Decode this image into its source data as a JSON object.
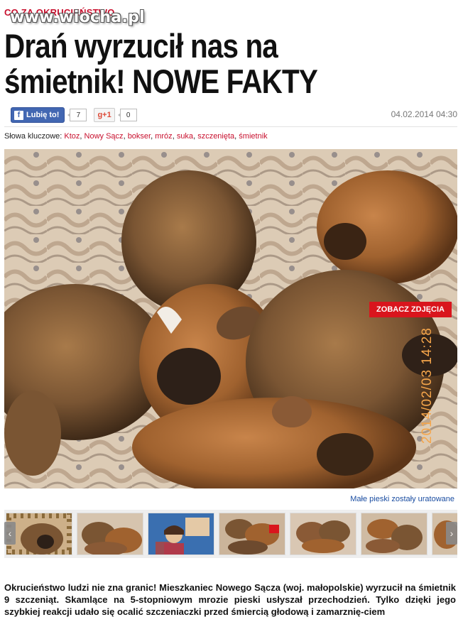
{
  "header": {
    "kicker": "CO ZA OKRUCIEŃSTWO",
    "watermark": "www.wiocha.pl"
  },
  "article": {
    "title": "Drań wyrzucił nas na śmietnik! NOWE FAKTY",
    "date": "04.02.2014 04:30",
    "keywords_label": "Słowa kluczowe:",
    "keywords": [
      "Ktoz",
      "Nowy Sącz",
      "bokser",
      "mróz",
      "suka",
      "szczenięta",
      "śmietnik"
    ],
    "body": "Okrucieństwo ludzi nie zna granic! Mieszkaniec Nowego Sącza (woj. małopolskie) wyrzucił na śmietnik 9 szczeniąt. Skamlące na 5-stopniowym mrozie pieski usłyszał przechodzień. Tylko dzięki jego szybkiej reakcji udało się ocalić szczeniaczki przed śmiercią głodową i zamarznię-ciem"
  },
  "social": {
    "fb_icon": "f",
    "fb_label": "Lubię to!",
    "fb_count": "7",
    "gplus_label": "g+1",
    "gplus_count": "0"
  },
  "gallery": {
    "see_photos_label": "ZOBACZ ZDJĘCIA",
    "photo_stamp": "2014/02/03 14:28",
    "caption": "Małe pieski zostały uratowane",
    "prev_arrow": "‹",
    "next_arrow": "›",
    "thumbnail_count": 7
  },
  "colors": {
    "accent": "#c8102e",
    "facebook": "#4267b2",
    "link": "#1a4da1",
    "button_red": "#d9151d"
  }
}
